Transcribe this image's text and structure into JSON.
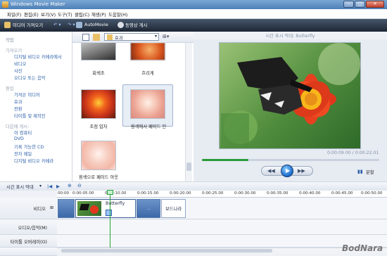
{
  "window": {
    "title": "Windows Movie Maker"
  },
  "menu": [
    "파일(F)",
    "편집(E)",
    "보기(V)",
    "도구(T)",
    "클립(C)",
    "재생(P)",
    "도움말(H)"
  ],
  "toolbar": {
    "import": "미디어 가져오기",
    "automovie": "AutoMovie",
    "publish": "동영상 게시"
  },
  "task_pane": {
    "title": "작업",
    "sections": [
      {
        "header": "가져오기",
        "links": [
          "디지털 비디오 카메라에서",
          "비디오",
          "사진",
          "오디오 또는 음악"
        ]
      },
      {
        "header": "편집",
        "links": [
          "가져온 미디어",
          "효과",
          "전환",
          "타이틀 및 제작진"
        ]
      },
      {
        "header": "다음에 게시:",
        "links": [
          "이 컴퓨터",
          "DVD",
          "기록 가능한 CD",
          "전자 메일",
          "디지털 비디오 카메라"
        ]
      }
    ]
  },
  "collection": {
    "dropdown": "효과",
    "items": [
      "회색조",
      "흐리게",
      "초점 입자",
      "흰색에서 페이드 인",
      "흰색으로 페이드 아웃"
    ]
  },
  "preview": {
    "title": "시간 표시 막대: Butterfly",
    "time": "0:00:09.00 / 0:00:22.01",
    "split": "분할",
    "seek_fraction": 0.26
  },
  "timeline": {
    "label": "시간 표시 막대",
    "ruler": [
      "00:00",
      "0:00:05.00",
      "0:00:10.00",
      "0:00:15.00",
      "0:00:20.00",
      "0:00:25.00",
      "0:00:30.00",
      "0:00:35.00",
      "0:00:40.00",
      "0:00:45.00",
      "0:00:50.00"
    ],
    "tracks": [
      "비디오",
      "오디오/음악(M)",
      "타이틀 오버레이(O)"
    ],
    "clips": [
      "Butterfly",
      "보드나라"
    ],
    "watermark": "BodNara"
  }
}
